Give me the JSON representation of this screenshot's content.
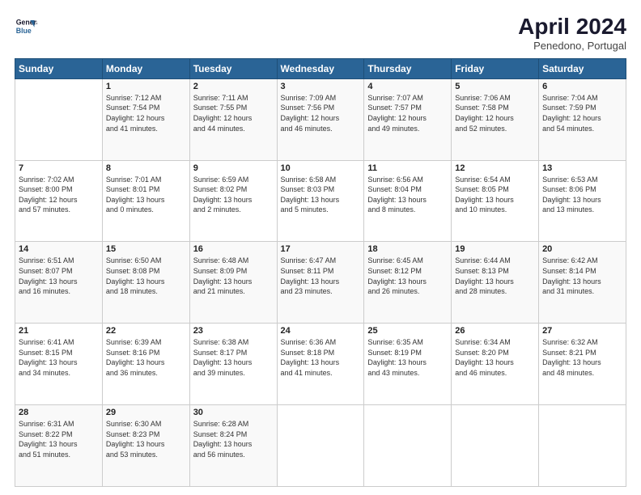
{
  "logo": {
    "line1": "General",
    "line2": "Blue"
  },
  "title": "April 2024",
  "subtitle": "Penedono, Portugal",
  "weekdays": [
    "Sunday",
    "Monday",
    "Tuesday",
    "Wednesday",
    "Thursday",
    "Friday",
    "Saturday"
  ],
  "weeks": [
    [
      {
        "day": "",
        "info": ""
      },
      {
        "day": "1",
        "info": "Sunrise: 7:12 AM\nSunset: 7:54 PM\nDaylight: 12 hours\nand 41 minutes."
      },
      {
        "day": "2",
        "info": "Sunrise: 7:11 AM\nSunset: 7:55 PM\nDaylight: 12 hours\nand 44 minutes."
      },
      {
        "day": "3",
        "info": "Sunrise: 7:09 AM\nSunset: 7:56 PM\nDaylight: 12 hours\nand 46 minutes."
      },
      {
        "day": "4",
        "info": "Sunrise: 7:07 AM\nSunset: 7:57 PM\nDaylight: 12 hours\nand 49 minutes."
      },
      {
        "day": "5",
        "info": "Sunrise: 7:06 AM\nSunset: 7:58 PM\nDaylight: 12 hours\nand 52 minutes."
      },
      {
        "day": "6",
        "info": "Sunrise: 7:04 AM\nSunset: 7:59 PM\nDaylight: 12 hours\nand 54 minutes."
      }
    ],
    [
      {
        "day": "7",
        "info": "Sunrise: 7:02 AM\nSunset: 8:00 PM\nDaylight: 12 hours\nand 57 minutes."
      },
      {
        "day": "8",
        "info": "Sunrise: 7:01 AM\nSunset: 8:01 PM\nDaylight: 13 hours\nand 0 minutes."
      },
      {
        "day": "9",
        "info": "Sunrise: 6:59 AM\nSunset: 8:02 PM\nDaylight: 13 hours\nand 2 minutes."
      },
      {
        "day": "10",
        "info": "Sunrise: 6:58 AM\nSunset: 8:03 PM\nDaylight: 13 hours\nand 5 minutes."
      },
      {
        "day": "11",
        "info": "Sunrise: 6:56 AM\nSunset: 8:04 PM\nDaylight: 13 hours\nand 8 minutes."
      },
      {
        "day": "12",
        "info": "Sunrise: 6:54 AM\nSunset: 8:05 PM\nDaylight: 13 hours\nand 10 minutes."
      },
      {
        "day": "13",
        "info": "Sunrise: 6:53 AM\nSunset: 8:06 PM\nDaylight: 13 hours\nand 13 minutes."
      }
    ],
    [
      {
        "day": "14",
        "info": "Sunrise: 6:51 AM\nSunset: 8:07 PM\nDaylight: 13 hours\nand 16 minutes."
      },
      {
        "day": "15",
        "info": "Sunrise: 6:50 AM\nSunset: 8:08 PM\nDaylight: 13 hours\nand 18 minutes."
      },
      {
        "day": "16",
        "info": "Sunrise: 6:48 AM\nSunset: 8:09 PM\nDaylight: 13 hours\nand 21 minutes."
      },
      {
        "day": "17",
        "info": "Sunrise: 6:47 AM\nSunset: 8:11 PM\nDaylight: 13 hours\nand 23 minutes."
      },
      {
        "day": "18",
        "info": "Sunrise: 6:45 AM\nSunset: 8:12 PM\nDaylight: 13 hours\nand 26 minutes."
      },
      {
        "day": "19",
        "info": "Sunrise: 6:44 AM\nSunset: 8:13 PM\nDaylight: 13 hours\nand 28 minutes."
      },
      {
        "day": "20",
        "info": "Sunrise: 6:42 AM\nSunset: 8:14 PM\nDaylight: 13 hours\nand 31 minutes."
      }
    ],
    [
      {
        "day": "21",
        "info": "Sunrise: 6:41 AM\nSunset: 8:15 PM\nDaylight: 13 hours\nand 34 minutes."
      },
      {
        "day": "22",
        "info": "Sunrise: 6:39 AM\nSunset: 8:16 PM\nDaylight: 13 hours\nand 36 minutes."
      },
      {
        "day": "23",
        "info": "Sunrise: 6:38 AM\nSunset: 8:17 PM\nDaylight: 13 hours\nand 39 minutes."
      },
      {
        "day": "24",
        "info": "Sunrise: 6:36 AM\nSunset: 8:18 PM\nDaylight: 13 hours\nand 41 minutes."
      },
      {
        "day": "25",
        "info": "Sunrise: 6:35 AM\nSunset: 8:19 PM\nDaylight: 13 hours\nand 43 minutes."
      },
      {
        "day": "26",
        "info": "Sunrise: 6:34 AM\nSunset: 8:20 PM\nDaylight: 13 hours\nand 46 minutes."
      },
      {
        "day": "27",
        "info": "Sunrise: 6:32 AM\nSunset: 8:21 PM\nDaylight: 13 hours\nand 48 minutes."
      }
    ],
    [
      {
        "day": "28",
        "info": "Sunrise: 6:31 AM\nSunset: 8:22 PM\nDaylight: 13 hours\nand 51 minutes."
      },
      {
        "day": "29",
        "info": "Sunrise: 6:30 AM\nSunset: 8:23 PM\nDaylight: 13 hours\nand 53 minutes."
      },
      {
        "day": "30",
        "info": "Sunrise: 6:28 AM\nSunset: 8:24 PM\nDaylight: 13 hours\nand 56 minutes."
      },
      {
        "day": "",
        "info": ""
      },
      {
        "day": "",
        "info": ""
      },
      {
        "day": "",
        "info": ""
      },
      {
        "day": "",
        "info": ""
      }
    ]
  ]
}
